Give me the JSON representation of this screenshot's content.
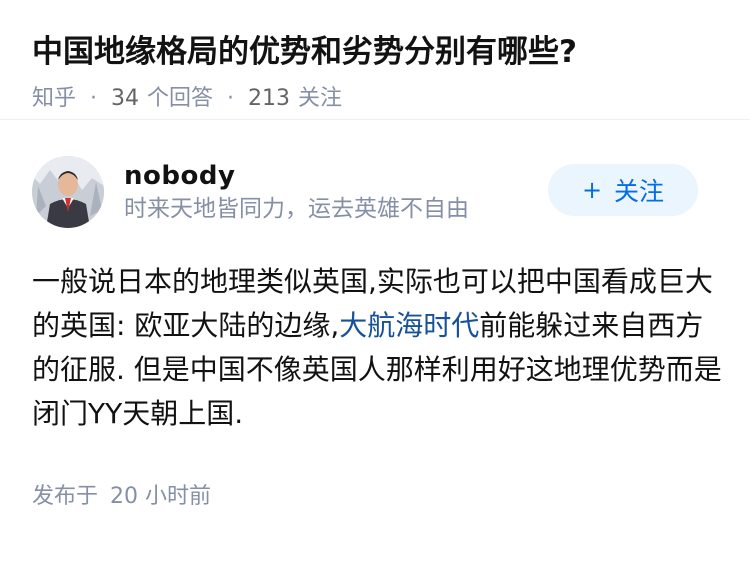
{
  "question": {
    "title": "中国地缘格局的优势和劣势分别有哪些?",
    "source": "知乎",
    "separator": "·",
    "answer_count": "34",
    "answer_label": "个回答",
    "follower_count": "213",
    "follower_label": "关注"
  },
  "answer": {
    "author": {
      "name": "nobody",
      "bio": "时来天地皆同力，运去英雄不自由",
      "avatar_icon": "user-avatar-photo"
    },
    "follow_button": {
      "plus": "+",
      "label": "关注"
    },
    "content": {
      "text_before": "一般说日本的地理类似英国,实际也可以把中国看成巨大的英国: 欧亚大陆的边缘,",
      "link_text": "大航海时代",
      "text_after": "前能躲过来自西方的征服. 但是中国不像英国人那样利用好这地理优势而是闭门YY天朝上国."
    },
    "publish": {
      "label": "发布于",
      "time": "20 小时前"
    }
  },
  "colors": {
    "accent": "#056de8",
    "link": "#175199",
    "meta_gray": "#8590a6",
    "follow_bg": "#ebf5fd"
  }
}
